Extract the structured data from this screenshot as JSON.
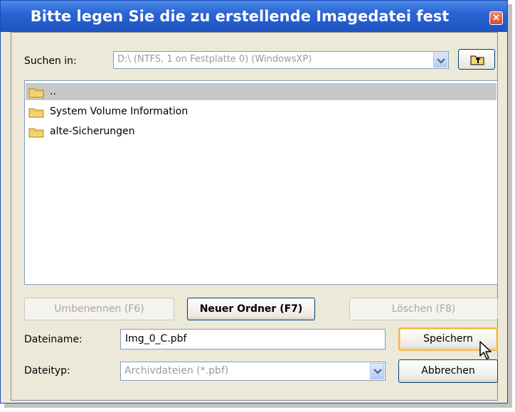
{
  "dialog": {
    "title": "Bitte legen Sie die zu erstellende Imagedatei fest",
    "close_symbol": "×"
  },
  "look_in": {
    "label": "Suchen in:",
    "value": "D:\\  (NTFS, 1 on Festplatte 0) (WindowsXP)"
  },
  "files": [
    {
      "name": "..",
      "icon": "folder-icon",
      "selected": true
    },
    {
      "name": "System Volume Information",
      "icon": "folder-icon",
      "selected": false
    },
    {
      "name": "alte-Sicherungen",
      "icon": "folder-icon",
      "selected": false
    }
  ],
  "actions": {
    "rename_label": "Umbenennen (F6)",
    "new_folder_label": "Neuer Ordner (F7)",
    "delete_label": "Löschen (F8)"
  },
  "filename": {
    "label": "Dateiname:",
    "value": "Img_0_C.pbf"
  },
  "filetype": {
    "label": "Dateityp:",
    "value": "Archivdateien (*.pbf)"
  },
  "buttons": {
    "save_label": "Speichern",
    "cancel_label": "Abbrechen"
  },
  "colors": {
    "titlebar": "#245edb",
    "window_bg": "#ece9d8",
    "selection": "#c8c8c8",
    "default_button_border": "#f0b848"
  }
}
